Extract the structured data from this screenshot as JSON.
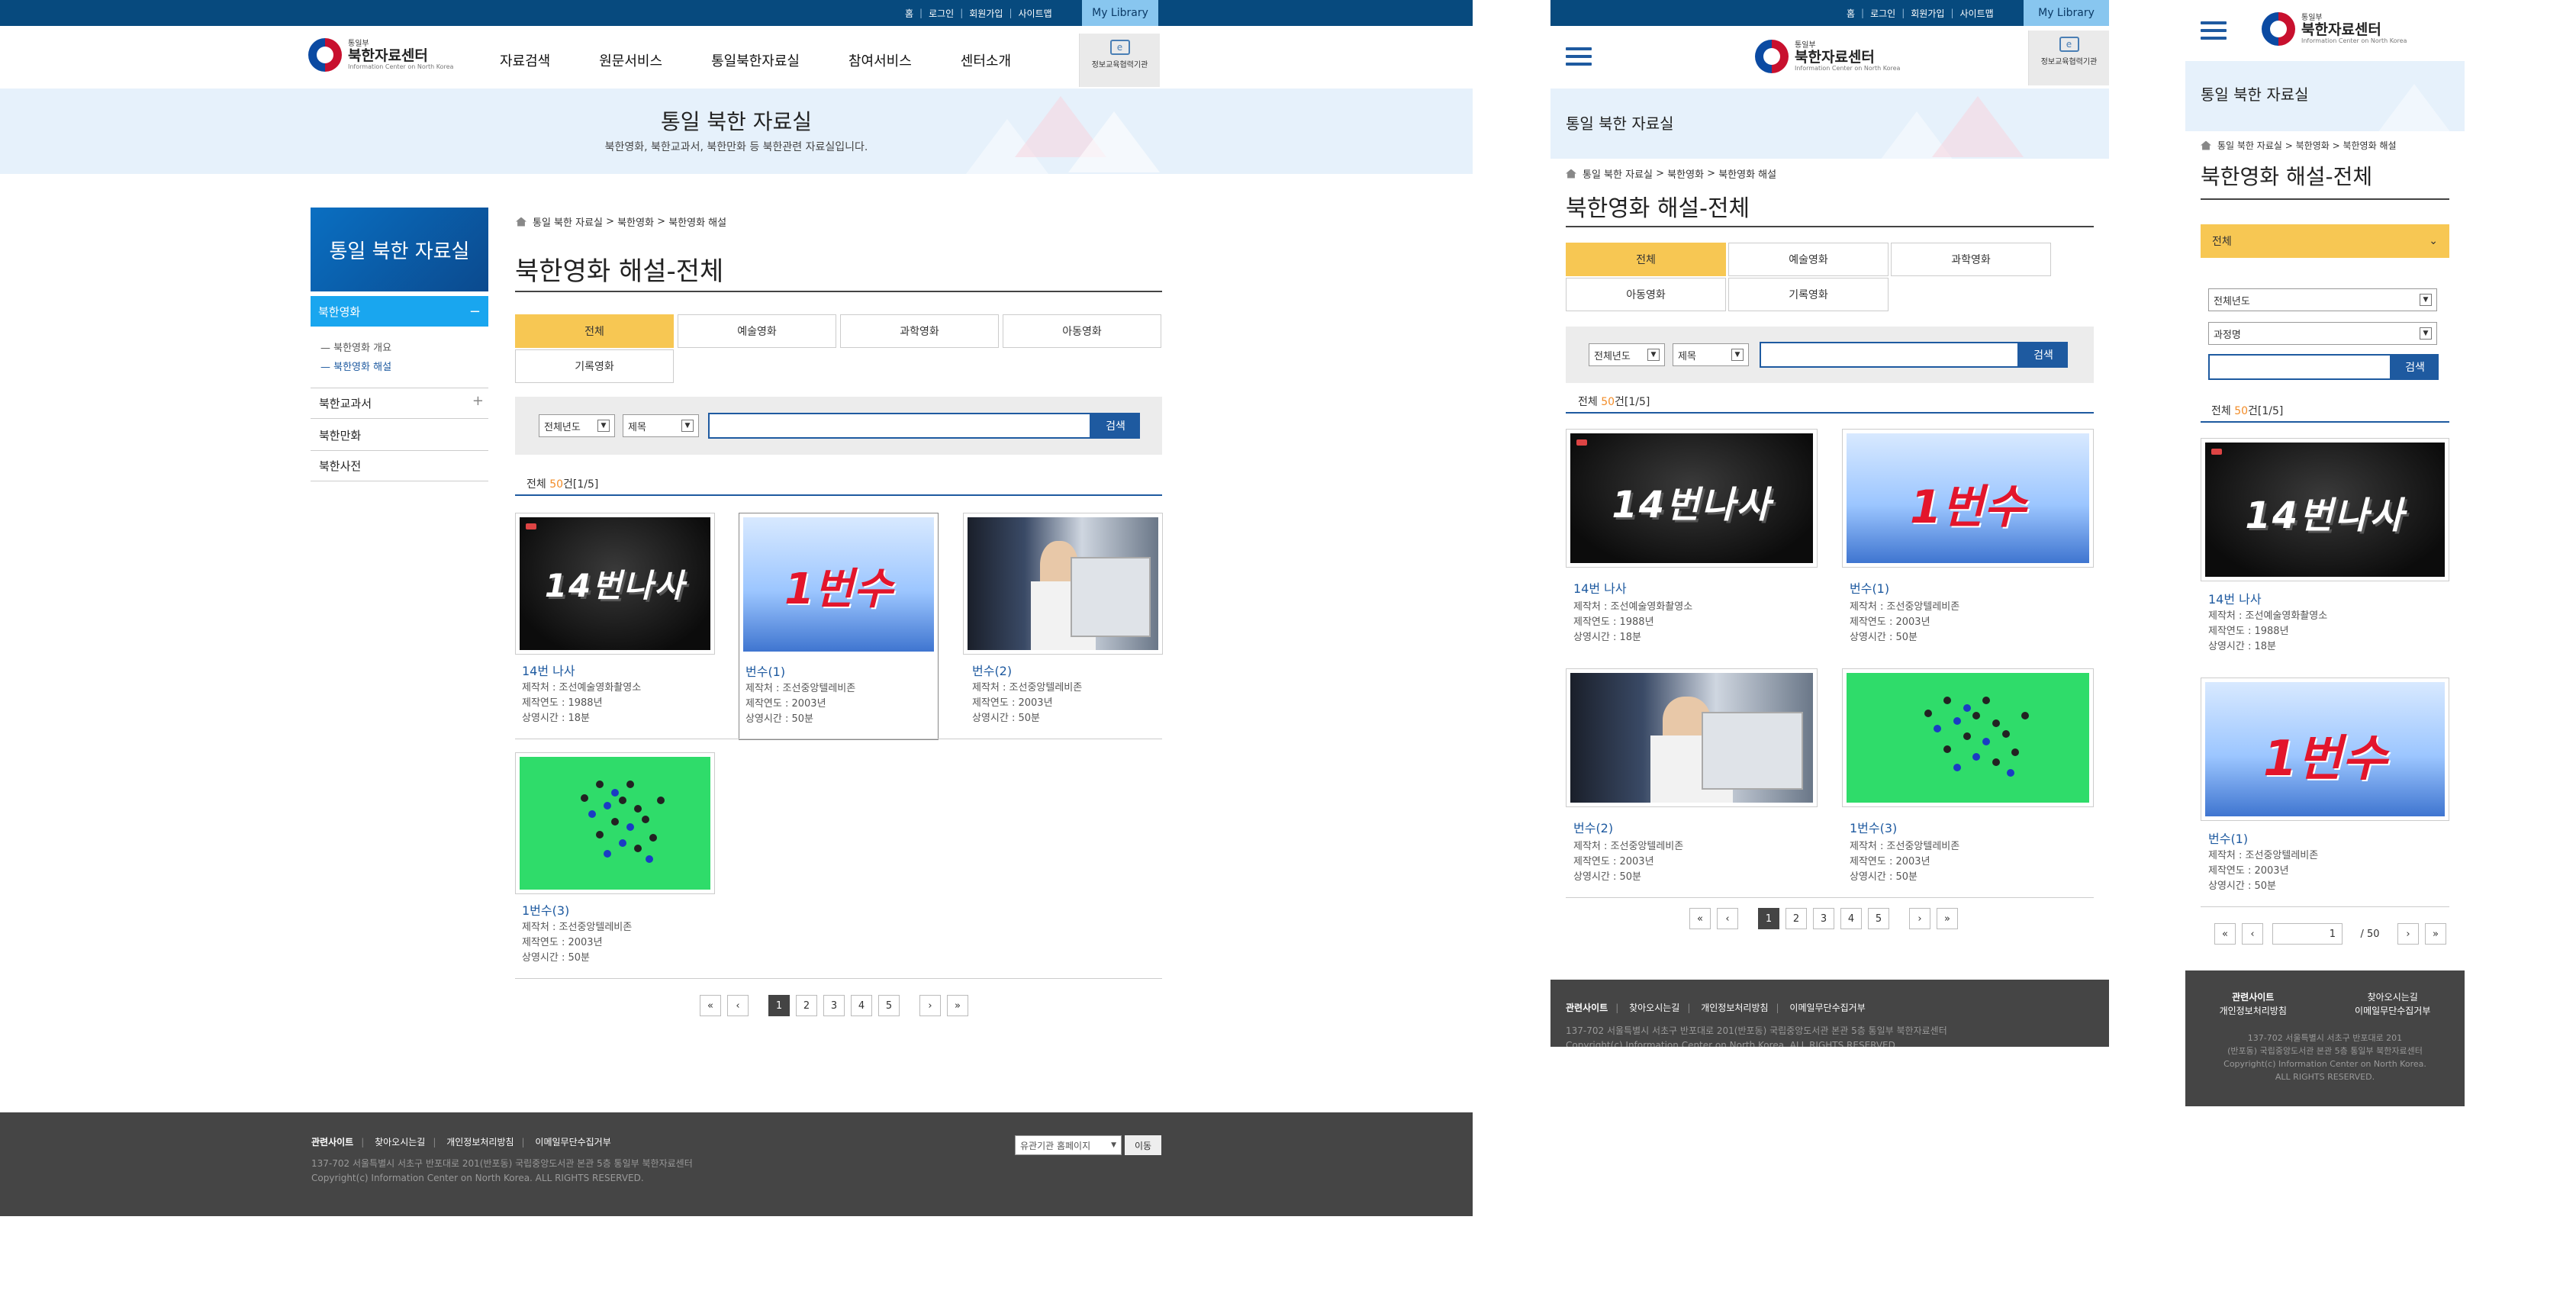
{
  "header": {
    "top_links": [
      "홈",
      "로그인",
      "회원가입",
      "사이트맵"
    ],
    "my_library": "My Library",
    "logo_small": "통일부",
    "logo_main": "북한자료센터",
    "logo_en": "Information Center on North Korea",
    "nav": [
      "자료검색",
      "원문서비스",
      "통일북한자료실",
      "참여서비스",
      "센터소개"
    ],
    "edu_label": "정보교육협력기관"
  },
  "banner": {
    "title": "통일 북한 자료실",
    "subtitle": "북한영화, 북한교과서, 북한만화 등 북한관련 자료실입니다."
  },
  "sidebar": {
    "title": "통일 북한 자료실",
    "active": "북한영화",
    "active_toggle": "−",
    "sub": [
      "북한영화 개요",
      "북한영화 해설"
    ],
    "items": [
      {
        "label": "북한교과서",
        "toggle": "+"
      },
      {
        "label": "북한만화",
        "toggle": ""
      },
      {
        "label": "북한사전",
        "toggle": ""
      }
    ]
  },
  "breadcrumb": [
    "통일 북한 자료실",
    "북한영화",
    "북한영화 해설"
  ],
  "page_title": "북한영화 해설-전체",
  "tabs": [
    "전체",
    "예술영화",
    "과학영화",
    "아동영화",
    "기록영화"
  ],
  "search": {
    "year_select": "전체년도",
    "field_select": "제목",
    "mobile_field_select": "과정명",
    "button": "검색",
    "input_value": ""
  },
  "count": {
    "prefix": "전체 ",
    "number": "50",
    "suffix": "건[1/5]"
  },
  "items": [
    {
      "title": "14번 나사",
      "maker": "제작처 : 조선예술영화촬영소",
      "year": "제작연도 : 1988년",
      "runtime": "상영시간 : 18분",
      "thumb_caption": "14번나사"
    },
    {
      "title": "번수(1)",
      "maker": "제작처 : 조선중앙텔레비존",
      "year": "제작연도 : 2003년",
      "runtime": "상영시간 : 50분",
      "thumb_caption": "1번수"
    },
    {
      "title": "번수(2)",
      "maker": "제작처 : 조선중앙텔레비존",
      "year": "제작연도 : 2003년",
      "runtime": "상영시간 : 50분",
      "thumb_caption": ""
    },
    {
      "title": "1번수(3)",
      "maker": "제작처 : 조선중앙텔레비존",
      "year": "제작연도 : 2003년",
      "runtime": "상영시간 : 50분",
      "thumb_caption": ""
    }
  ],
  "pagination": {
    "first": "«",
    "prev": "‹",
    "next": "›",
    "last": "»",
    "pages": [
      "1",
      "2",
      "3",
      "4",
      "5"
    ],
    "current": "1",
    "mobile_current": "1",
    "mobile_total": "/ 50"
  },
  "footer": {
    "links": [
      "관련사이트",
      "찾아오시는길",
      "개인정보처리방침",
      "이메일무단수집거부"
    ],
    "address": "137-702 서울특별시 서초구 반포대로 201(반포동) 국립중앙도서관 본관 5층 통일부 북한자료센터",
    "copyright": "Copyright(c) Information Center on North Korea. ALL RIGHTS RESERVED.",
    "mobile_address_1": "137-702 서울특별시 서초구 반포대로 201",
    "mobile_address_2": "(반포동) 국립중앙도서관 본관 5층 통일부 북한자료센터",
    "mobile_copyright_1": "Copyright(c) Information Center on North Korea.",
    "mobile_copyright_2": "ALL RIGHTS RESERVED.",
    "family_select": "유관기관 홈페이지",
    "go_button": "이동"
  },
  "colors": {
    "navy": "#074a7e",
    "accent_blue": "#1e5aa0",
    "tab_active": "#f7c753",
    "lnb_active": "#19a6ef",
    "footer": "#454545"
  }
}
